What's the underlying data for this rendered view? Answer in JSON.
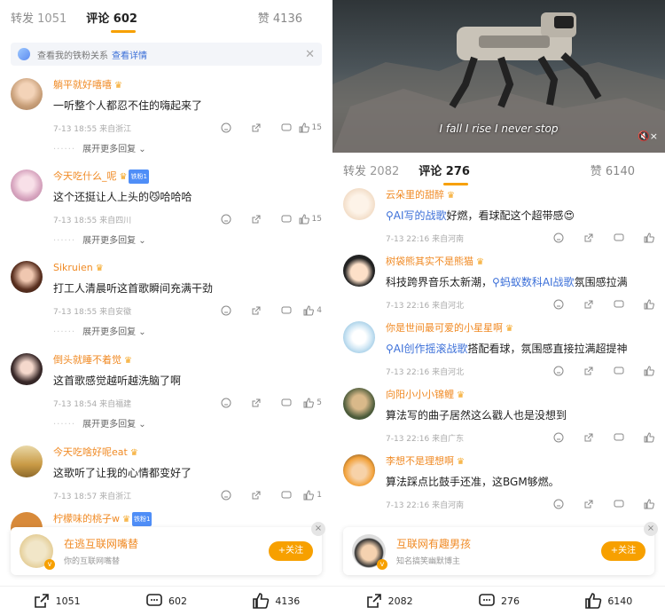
{
  "left": {
    "tabs": {
      "repost": "转发",
      "repost_count": "1051",
      "comment": "评论",
      "comment_count": "602",
      "likes": "赞 4136"
    },
    "banner": {
      "text": "查看我的铁粉关系",
      "link": "查看详情"
    },
    "comments": [
      {
        "name": "躺平就好嘻嘻",
        "text": "一听整个人都忍不住的嗨起来了",
        "meta": "7-13 18:55 来自浙江",
        "likes": "15",
        "more": "展开更多回复"
      },
      {
        "name": "今天吃什么_呢",
        "badge": "铁粉1",
        "text": "这个还挺让人上头的😼哈哈哈",
        "meta": "7-13 18:55 来自四川",
        "likes": "15",
        "more": "展开更多回复"
      },
      {
        "name": "Sikruien",
        "text": "打工人清晨听这首歌瞬间充满干劲",
        "meta": "7-13 18:55 来自安徽",
        "likes": "4",
        "more": "展开更多回复"
      },
      {
        "name": "倒头就睡不着觉",
        "text": "这首歌感觉越听越洗脑了啊",
        "meta": "7-13 18:54 来自福建",
        "likes": "5",
        "more": "展开更多回复"
      },
      {
        "name": "今天吃啥好呢eat",
        "text": "这歌听了让我的心情都变好了",
        "meta": "7-13 18:57 来自浙江",
        "likes": "1"
      },
      {
        "name": "柠檬味的桃子w",
        "badge": "铁粉1",
        "text": "",
        "meta": "",
        "likes": ""
      }
    ],
    "follow": {
      "name": "在逃互联网嘴替",
      "desc": "你的互联网嘴替",
      "button": "+关注",
      "close": "×"
    },
    "bottom": {
      "repost": "1051",
      "comment": "602",
      "like": "4136"
    }
  },
  "right": {
    "video": {
      "caption": "I fall I rise I never stop",
      "mute": "🔇×"
    },
    "tabs": {
      "repost": "转发",
      "repost_count": "2082",
      "comment": "评论",
      "comment_count": "276",
      "likes": "赞 6140"
    },
    "comments": [
      {
        "name": "云朵里的甜醉",
        "link": "AI写的战歌",
        "text": "好燃，看球配这个超带感😍",
        "meta": "7-13 22:16 来自河南"
      },
      {
        "name": "树袋熊其实不是熊猫",
        "text_pre": "科技跨界音乐太新潮，",
        "link": "蚂蚁数科AI战歌",
        "text": "氛围感拉满",
        "meta": "7-13 22:16 来自河北"
      },
      {
        "name": "你是世间最可爱的小星星啊",
        "link": "AI创作摇滚战歌",
        "text": "搭配看球，氛围感直接拉满超提神",
        "meta": "7-13 22:16 来自河北"
      },
      {
        "name": "向阳小小小锦鲤",
        "text": "算法写的曲子居然这么戳人也是没想到",
        "meta": "7-13 22:16 来自广东"
      },
      {
        "name": "李想不是理想啊",
        "text": "算法踩点比鼓手还准，这BGM够燃。",
        "meta": "7-13 22:16 来自河南"
      }
    ],
    "follow": {
      "name": "互联网有趣男孩",
      "desc": "知名搞笑幽默博主",
      "button": "+关注",
      "close": "×"
    },
    "bottom": {
      "repost": "2082",
      "comment": "276",
      "like": "6140"
    }
  },
  "colors": {
    "accent": "#f7a000",
    "name": "#f08a24",
    "link": "#3b6fd8"
  }
}
